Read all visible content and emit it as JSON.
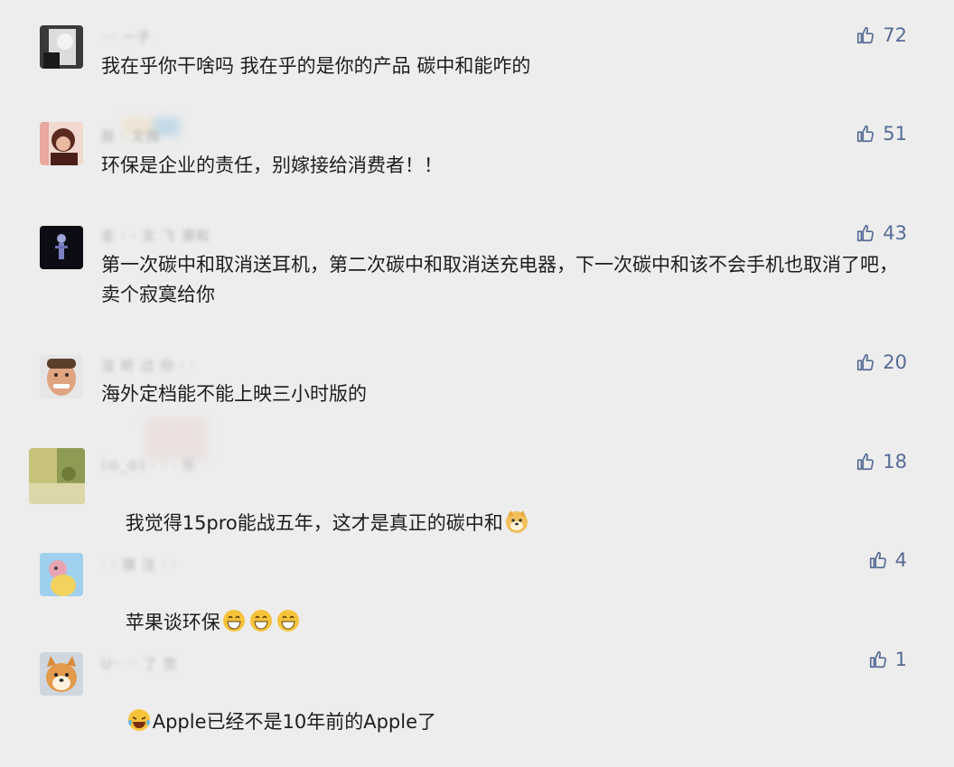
{
  "comments": [
    {
      "username": "··· 一子",
      "text": "我在乎你干啥吗 我在乎的是你的产品 碳中和能咋的",
      "likes": "72"
    },
    {
      "username": "脱 · 文微",
      "text": "环保是企业的责任，别嫁接给消费者！！",
      "likes": "51"
    },
    {
      "username": "走 · · 文 飞 潮和",
      "text": "第一次碳中和取消送耳机，第二次碳中和取消送充电器，下一次碳中和该不会手机也取消了吧，卖个寂寞给你",
      "likes": "43"
    },
    {
      "username": "没 听 过 你 · ·",
      "text": "海外定档能不能上映三小时版的",
      "likes": "20"
    },
    {
      "username": "(⊙_⊙) · · · 乐",
      "text_before": "我觉得15pro能战五年，这才是真正的碳中和",
      "likes": "18"
    },
    {
      "username": "· · 旗 注 · ·",
      "text_before": "苹果谈环保",
      "likes": "4"
    },
    {
      "username": "U·· ·· 了 京",
      "text_after": "Apple已经不是10年前的Apple了",
      "likes": "1"
    }
  ],
  "icons": {
    "like": "thumbs-up-outline-icon",
    "emoji_doge": "doge-emoji",
    "emoji_grin": "grin-emoji",
    "emoji_laugh": "laugh-cry-emoji"
  },
  "colors": {
    "background": "#ededed",
    "like_count": "#576b95",
    "text": "#1d1d1d"
  }
}
